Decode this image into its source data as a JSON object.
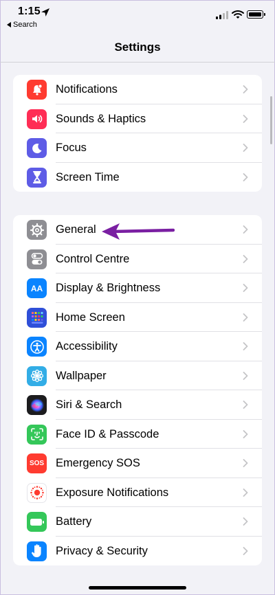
{
  "status": {
    "time": "1:15",
    "back_label": "Search"
  },
  "nav": {
    "title": "Settings"
  },
  "groups": [
    {
      "items": [
        {
          "label": "Notifications",
          "icon": "bell-icon",
          "color": "#ff3b30"
        },
        {
          "label": "Sounds & Haptics",
          "icon": "speaker-icon",
          "color": "#ff2d55"
        },
        {
          "label": "Focus",
          "icon": "moon-icon",
          "color": "#5e5ce6"
        },
        {
          "label": "Screen Time",
          "icon": "hourglass-icon",
          "color": "#5e5ce6"
        }
      ]
    },
    {
      "items": [
        {
          "label": "General",
          "icon": "gear-icon",
          "color": "#8e8e93"
        },
        {
          "label": "Control Centre",
          "icon": "toggles-icon",
          "color": "#8e8e93"
        },
        {
          "label": "Display & Brightness",
          "icon": "text-size-icon",
          "color": "#0a84ff",
          "icon_text": "AA"
        },
        {
          "label": "Home Screen",
          "icon": "app-grid-icon",
          "color": "#2f4fd8"
        },
        {
          "label": "Accessibility",
          "icon": "accessibility-icon",
          "color": "#0a84ff"
        },
        {
          "label": "Wallpaper",
          "icon": "flower-icon",
          "color": "#32ade6"
        },
        {
          "label": "Siri & Search",
          "icon": "siri-icon",
          "color": "#1c1c1e"
        },
        {
          "label": "Face ID & Passcode",
          "icon": "face-id-icon",
          "color": "#34c759"
        },
        {
          "label": "Emergency SOS",
          "icon": "sos-icon",
          "color": "#ff3b30",
          "icon_text": "SOS"
        },
        {
          "label": "Exposure Notifications",
          "icon": "exposure-icon",
          "color": "#ffffff"
        },
        {
          "label": "Battery",
          "icon": "battery-icon",
          "color": "#34c759"
        },
        {
          "label": "Privacy & Security",
          "icon": "hand-icon",
          "color": "#0a84ff"
        }
      ]
    }
  ],
  "annotation": {
    "icon": "arrow-left-icon",
    "color": "#7a1fa2",
    "points_to": "General"
  }
}
